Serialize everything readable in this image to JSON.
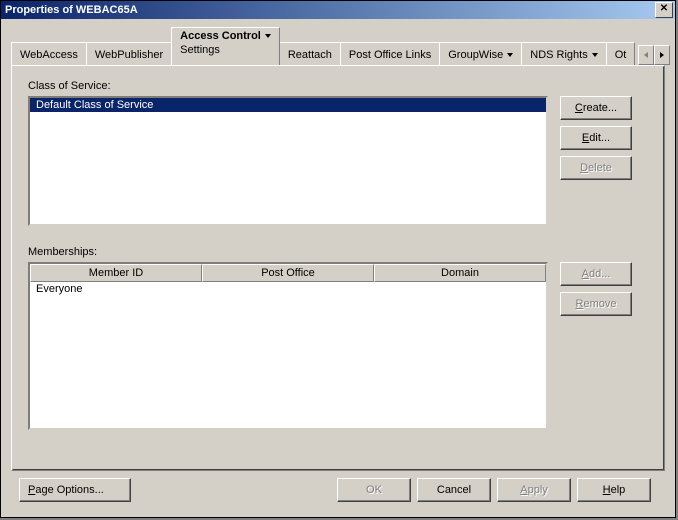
{
  "window": {
    "title": "Properties of WEBAC65A"
  },
  "tabs": {
    "items": [
      {
        "label": "WebAccess",
        "dropdown": false
      },
      {
        "label": "WebPublisher",
        "dropdown": false
      },
      {
        "label": "Access Control",
        "dropdown": true,
        "active": true,
        "subpage": "Settings"
      },
      {
        "label": "Reattach",
        "dropdown": false
      },
      {
        "label": "Post Office Links",
        "dropdown": false
      },
      {
        "label": "GroupWise",
        "dropdown": true
      },
      {
        "label": "NDS Rights",
        "dropdown": true
      },
      {
        "label": "Ot",
        "dropdown": false
      }
    ]
  },
  "class_of_service": {
    "label": "Class of Service:",
    "items": [
      "Default Class of Service"
    ],
    "buttons": {
      "create": "Create...",
      "edit": "Edit...",
      "delete": "Delete"
    }
  },
  "memberships": {
    "label": "Memberships:",
    "columns": [
      "Member ID",
      "Post Office",
      "Domain"
    ],
    "rows": [
      {
        "member_id": "Everyone",
        "post_office": "",
        "domain": ""
      }
    ],
    "buttons": {
      "add": "Add...",
      "remove": "Remove"
    }
  },
  "bottom": {
    "page_options": "Page Options...",
    "ok": "OK",
    "cancel": "Cancel",
    "apply": "Apply",
    "help": "Help"
  }
}
